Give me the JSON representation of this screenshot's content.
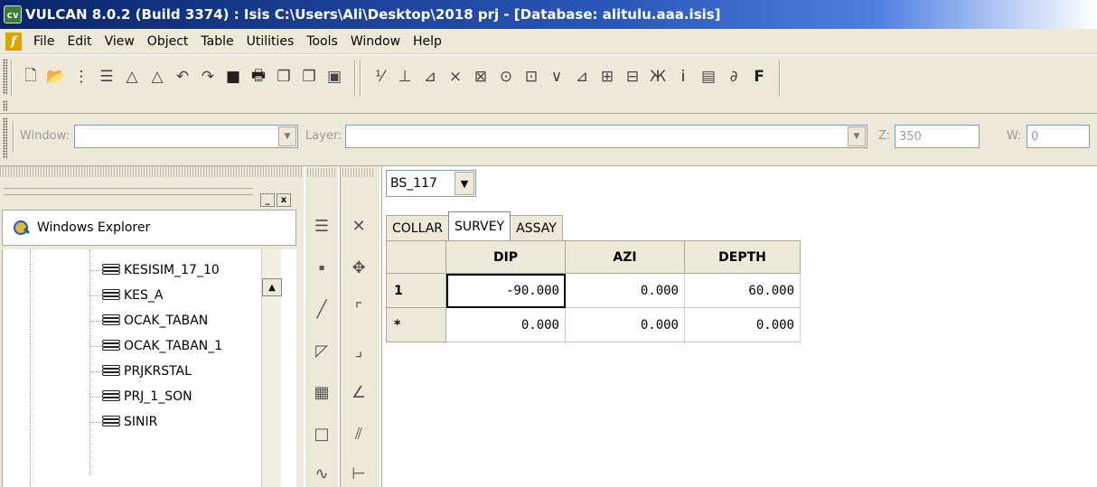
{
  "window": {
    "title": "VULCAN 8.0.2 (Build 3374) : Isis  C:\\Users\\Ali\\Desktop\\2018 prj - [Database: alitulu.aaa.isis]",
    "app_icon_text": "cv"
  },
  "menu": {
    "icon_text": "f",
    "items": [
      "File",
      "Edit",
      "View",
      "Object",
      "Table",
      "Utilities",
      "Tools",
      "Window",
      "Help"
    ]
  },
  "toolbar": {
    "window_label": "Window:",
    "layer_label": "Layer:",
    "z_label": "Z:",
    "z_value": "350",
    "w_label": "W:",
    "w_value": "0"
  },
  "left_panel": {
    "header": "Windows Explorer",
    "min_btn": "_",
    "close_btn": "x",
    "tree_items": [
      "KESISIM_17_10",
      "KES_A",
      "OCAK_TABAN",
      "OCAK_TABAN_1",
      "PRJKRSTAL",
      "PRJ_1_SON",
      "SINIR"
    ]
  },
  "main": {
    "hole_id": "BS_117",
    "tabs": [
      "COLLAR",
      "SURVEY",
      "ASSAY"
    ],
    "active_tab": "SURVEY",
    "columns": [
      "DIP",
      "AZI",
      "DEPTH"
    ],
    "rows": [
      {
        "label": "1",
        "values": [
          "-90.000",
          "0.000",
          "60.000"
        ]
      },
      {
        "label": "*",
        "values": [
          "0.000",
          "0.000",
          "0.000"
        ]
      }
    ]
  }
}
